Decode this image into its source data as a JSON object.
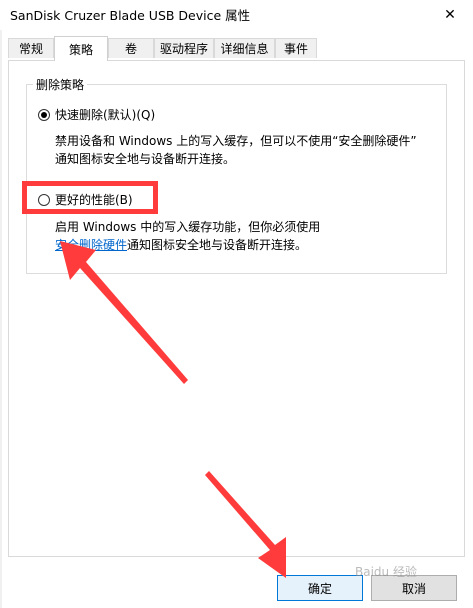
{
  "window": {
    "title": "SanDisk Cruzer Blade USB Device 属性",
    "close_glyph": "✕"
  },
  "tabs": [
    {
      "label": "常规",
      "active": false
    },
    {
      "label": "策略",
      "active": true
    },
    {
      "label": "卷",
      "active": false
    },
    {
      "label": "驱动程序",
      "active": false
    },
    {
      "label": "详细信息",
      "active": false
    },
    {
      "label": "事件",
      "active": false
    }
  ],
  "group": {
    "label": "删除策略",
    "options": [
      {
        "label": "快速删除(默认)(Q)",
        "checked": true,
        "desc_line1": "禁用设备和 Windows 上的写入缓存，但可以不使用“安全删除硬件”",
        "desc_line2": "通知图标安全地与设备断开连接。"
      },
      {
        "label": "更好的性能(B)",
        "checked": false,
        "desc_line1": "启用 Windows 中的写入缓存功能，但你必须使用",
        "desc_link": "安全删除硬件",
        "desc_line2_rest": "通知图标安全地与设备断开连接。"
      }
    ]
  },
  "buttons": {
    "ok": "确定",
    "cancel": "取消"
  },
  "watermark": "Baidu 经验",
  "colors": {
    "annotation_red": "#ff3b3b",
    "link_blue": "#0066cc"
  }
}
